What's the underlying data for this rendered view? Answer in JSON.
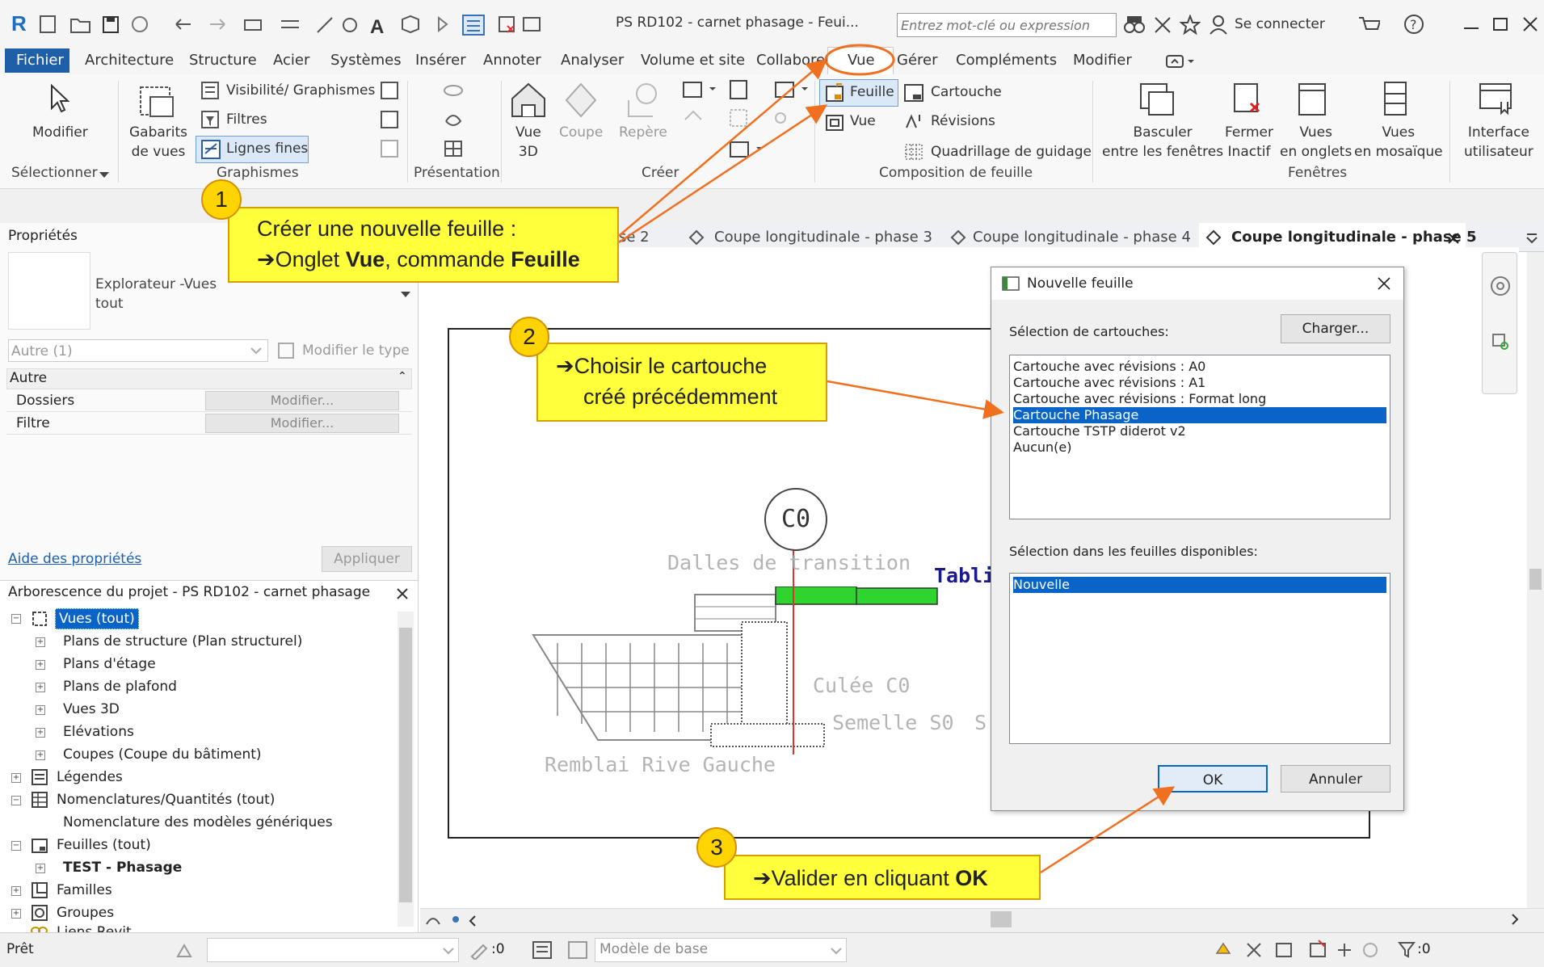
{
  "app": {
    "title": "PS RD102 - carnet phasage  - Feui...",
    "search_placeholder": "Entrez mot-clé ou expression",
    "signin": "Se connecter"
  },
  "menu": [
    "Fichier",
    "Architecture",
    "Structure",
    "Acier",
    "Systèmes",
    "Insérer",
    "Annoter",
    "Analyser",
    "Volume et site",
    "Collaborer",
    "Vue",
    "Gérer",
    "Compléments",
    "Modifier"
  ],
  "ribbon": {
    "modifier": "Modifier",
    "selectionner": "Sélectionner",
    "gabarits": [
      "Gabarits",
      "de vues"
    ],
    "visibilite": "Visibilité/ Graphismes",
    "filtres": "Filtres",
    "lignes_fines": "Lignes fines",
    "graphismes": "Graphismes",
    "presentation": "Présentation",
    "vue3d": [
      "Vue",
      "3D"
    ],
    "coupe": "Coupe",
    "repere": "Repère",
    "creer": "Créer",
    "feuille": "Feuille",
    "vue": "Vue",
    "cartouche": "Cartouche",
    "revisions": "Révisions",
    "quadrillage": "Quadrillage de guidage",
    "composition": "Composition de feuille",
    "basculer": [
      "Basculer",
      "entre les fenêtres"
    ],
    "fermer": [
      "Fermer",
      "Inactif"
    ],
    "vues_onglets": [
      "Vues",
      "en onglets"
    ],
    "vues_mosaique": [
      "Vues",
      "en mosaïque"
    ],
    "interface": [
      "Interface",
      "utilisateur"
    ],
    "fenetres": "Fenêtres"
  },
  "properties": {
    "title": "Propriétés",
    "type_name": [
      "Explorateur -Vues",
      "tout"
    ],
    "instance": "Autre (1)",
    "modifier_type": "Modifier le type",
    "section": "Autre",
    "rows": [
      {
        "label": "Dossiers",
        "value": "Modifier..."
      },
      {
        "label": "Filtre",
        "value": "Modifier..."
      }
    ],
    "help": "Aide des propriétés",
    "apply": "Appliquer"
  },
  "tree": {
    "title": "Arborescence du projet - PS RD102 - carnet phasage",
    "root": "Vues (tout)",
    "items": [
      "Plans de structure (Plan structurel)",
      "Plans d'étage",
      "Plans de plafond",
      "Vues 3D",
      "Elévations",
      "Coupes (Coupe du bâtiment)"
    ],
    "legendes": "Légendes",
    "nomenclatures": "Nomenclatures/Quantités (tout)",
    "nom_item": "Nomenclature des modèles génériques",
    "feuilles": "Feuilles (tout)",
    "test_phasage": "TEST - Phasage",
    "familles": "Familles",
    "groupes": "Groupes",
    "liens": "Liens Revit"
  },
  "tabs": [
    "se 2",
    "Coupe longitudinale - phase 3",
    "Coupe longitudinale - phase 4",
    "Coupe longitudinale - phase 5"
  ],
  "drawing": {
    "tag": "C0",
    "labels": [
      "Dalles de transition",
      "Tablie",
      "Culée C0",
      "Semelle S0",
      "S",
      "Remblai Rive Gauche"
    ]
  },
  "dialog": {
    "title": "Nouvelle feuille",
    "select_cartouche": "Sélection de cartouches:",
    "charger": "Charger...",
    "cartouches": [
      "Cartouche avec révisions : A0",
      "Cartouche avec révisions : A1",
      "Cartouche avec révisions : Format long",
      "Cartouche Phasage",
      "Cartouche TSTP diderot v2",
      "Aucun(e)"
    ],
    "selected_index": 3,
    "select_feuilles": "Sélection dans les feuilles disponibles:",
    "feuilles": [
      "Nouvelle"
    ],
    "ok": "OK",
    "annuler": "Annuler"
  },
  "callouts": {
    "c1_num": "1",
    "c1_line1": "Créer une nouvelle feuille :",
    "c1_pre": "➔Onglet ",
    "c1_b1": "Vue",
    "c1_mid": ", commande ",
    "c1_b2": "Feuille",
    "c2_num": "2",
    "c2_line1": "➔Choisir le cartouche",
    "c2_line2": "créé précédemment",
    "c3_num": "3",
    "c3_pre": "➔Valider en cliquant ",
    "c3_b": "OK"
  },
  "status": {
    "ready": "Prêt",
    "count0": ":0",
    "model": "Modèle de base",
    "filter0": ":0"
  },
  "colors": {
    "accent": "#0a64c8",
    "callout": "#ffff3b",
    "arrow": "#f07020",
    "selection": "#3399ff"
  }
}
